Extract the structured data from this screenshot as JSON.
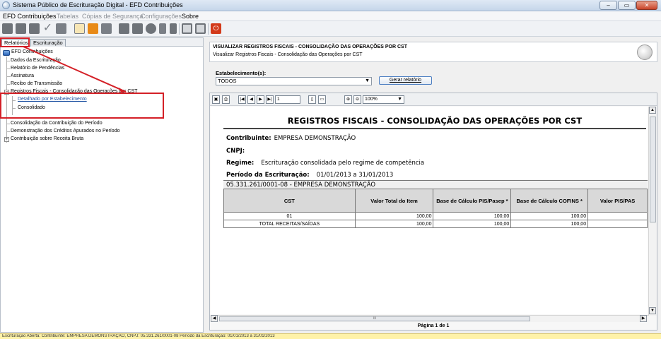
{
  "window": {
    "title": "Sistema Público de Escrituração Digital - EFD Contribuições",
    "controls": [
      "–",
      "▭",
      "✕"
    ]
  },
  "menu": {
    "items": [
      {
        "label": "EFD Contribuições",
        "enabled": true
      },
      {
        "label": "Tabelas",
        "enabled": false
      },
      {
        "label": "Cópias de Segurança",
        "enabled": false
      },
      {
        "label": "Configurações",
        "enabled": false
      },
      {
        "label": "Sobre",
        "enabled": true
      }
    ]
  },
  "toolbar": {
    "icons": [
      "new-file-icon",
      "open-file-icon",
      "folder-icon",
      "validate-check-icon",
      "sign-icon",
      "print-icon",
      "close-file-icon",
      "delete-icon",
      "tools-icon",
      "users-icon",
      "globe-icon",
      "mail-icon",
      "shield-icon",
      "grid-icon",
      "report-icon",
      "power-icon"
    ],
    "colors": {
      "power": "#d33a1a",
      "green": "#3f9b2f",
      "gray": "#7a7f86",
      "orange": "#e88a17"
    }
  },
  "left_panel": {
    "tabs": [
      "Relatórios",
      "Escrituração"
    ],
    "active_tab": "Relatórios",
    "tree": {
      "root": "EFD Contribuições",
      "items": [
        "Dados da Escrituração",
        "Relatório de Pendências",
        "Assinatura",
        "Recibo de Transmissão",
        "Registros Fiscais - Consolidação das Operações por CST",
        "Detalhado por Estabelecimento",
        "Consolidado",
        "Consolidação da Contribuição do Período",
        "Demonstração dos Créditos Apurados no Período",
        "Contribuição sobre Receita Bruta"
      ]
    }
  },
  "report_panel": {
    "header_title": "VISUALIZAR REGISTROS FISCAIS - CONSOLIDAÇÃO DAS OPERAÇÕES POR CST",
    "header_subtitle": "Visualizar Registros Fiscais - Consolidação das Operações por CST",
    "establishment_label": "Estabelecimento(s):",
    "establishment_value": "TODOS",
    "generate_button": "Gerar relatório",
    "viewer": {
      "page_input": "1",
      "zoom": "100%",
      "page_label": "Página 1 de 1",
      "hscroll_label": "III"
    },
    "report": {
      "title": "REGISTROS FISCAIS - CONSOLIDAÇÃO DAS OPERAÇÕES POR CST",
      "contribuinte_label": "Contribuinte:",
      "contribuinte_value": "EMPRESA DEMONSTRAÇÃO",
      "cnpj_label": "CNPJ:",
      "cnpj_value": "",
      "regime_label": "Regime:",
      "regime_value": "Escrituração consolidada pelo regime de competência",
      "periodo_label": "Período da Escrituração:",
      "periodo_value": "01/01/2013 a 31/01/2013",
      "establishment_line": "05.331.261/0001-08 - EMPRESA DEMONSTRAÇÃO",
      "columns": [
        "CST",
        "Valor Total do Item",
        "Base de Cálculo PIS/Pasep *",
        "Base de Cálculo COFINS *",
        "Valor PIS/PAS"
      ],
      "rows": [
        [
          "01",
          "100,00",
          "100,00",
          "100,00",
          ""
        ],
        [
          "TOTAL RECEITAS/SAÍDAS",
          "100,00",
          "100,00",
          "100,00",
          ""
        ]
      ]
    }
  },
  "status_bar": {
    "text": "Escrituração Aberta: Contribuinte: EMPRESA DEMONSTRAÇÃO, CNPJ: 05.331.261/0001-08 Período da Escrituração: 01/01/2013 a 31/01/2013"
  },
  "annotation": {
    "color": "#d42027"
  }
}
